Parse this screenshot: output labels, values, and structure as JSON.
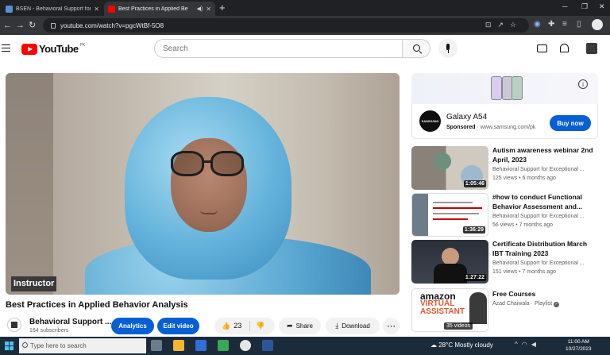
{
  "browser": {
    "tabs": [
      {
        "title": "BSEN - Behavioral Support for E",
        "active": false
      },
      {
        "title": "Best Practices in Applied Be",
        "active": true
      }
    ],
    "url": "youtube.com/watch?v=pgcWtBf-5O8"
  },
  "header": {
    "logo_text": "YouTube",
    "country_code": "PK",
    "search_placeholder": "Search"
  },
  "player": {
    "overlay_label": "Instructor"
  },
  "video": {
    "title": "Best Practices in Applied Behavior Analysis",
    "channel_name": "Behavioral Support ...",
    "subscribers": "164 subscribers",
    "analytics_label": "Analytics",
    "edit_label": "Edit video",
    "likes": "23",
    "share_label": "Share",
    "download_label": "Download"
  },
  "ad": {
    "logo_text": "SAMSUNG",
    "title": "Galaxy A54",
    "sponsored": "Sponsored",
    "domain": "www.samsung.com/pk",
    "cta": "Buy now"
  },
  "recommended": [
    {
      "title": "Autism awareness webinar 2nd April, 2023",
      "channel": "Behavioral Support for Exceptional ...",
      "meta": "125 views • 6 months ago",
      "duration": "1:05:46"
    },
    {
      "title": "#how to conduct Functional Behavior Assessment and...",
      "channel": "Behavioral Support for Exceptional ...",
      "meta": "56 views • 7 months ago",
      "duration": "1:36:29"
    },
    {
      "title": "Certificate Distribution March IBT Training 2023",
      "channel": "Behavioral Support for Exceptional ...",
      "meta": "151 views • 7 months ago",
      "duration": "1:27:22"
    },
    {
      "title": "Free Courses",
      "channel": "Azad Chaiwala",
      "meta": "Playlist",
      "badge": "35 videos"
    }
  ],
  "taskbar": {
    "search_placeholder": "Type here to search",
    "temperature": "28°C",
    "weather": "Mostly cloudy",
    "time": "11:00 AM",
    "date": "10/27/2023"
  },
  "colors": {
    "youtube_red": "#ff0000",
    "primary_blue": "#065fd4",
    "taskbar": "#1c2b3a",
    "chrome_dark": "#202124"
  }
}
